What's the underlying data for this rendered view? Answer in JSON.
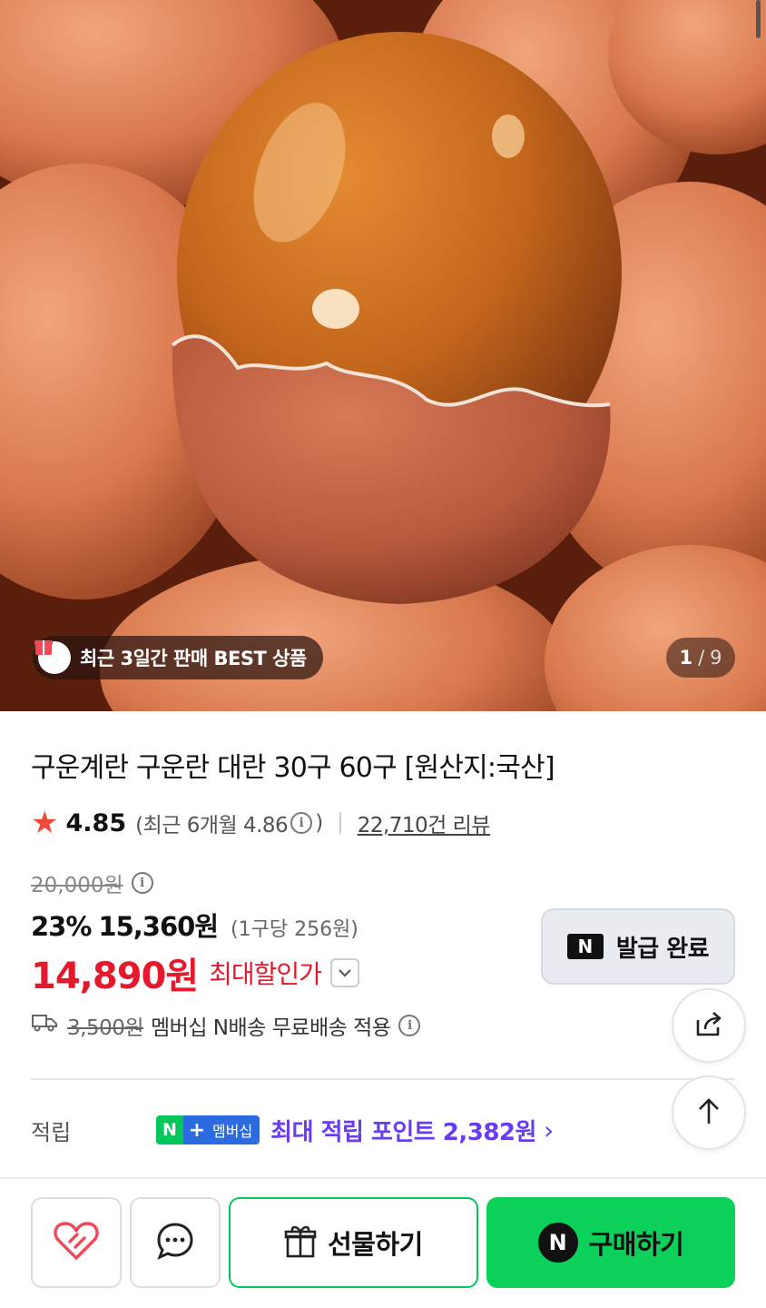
{
  "hero": {
    "badge_text": "최근 3일간 판매 BEST 상품",
    "pager_current": "1",
    "pager_separator": "/",
    "pager_total": "9"
  },
  "product": {
    "title": "구운계란 구운란 대란 30구 60구 [원산지:국산]",
    "rating": "4.85",
    "recent_rating_text": "(최근 6개월 4.86",
    "recent_rating_close": ")",
    "review_count_text": "22,710건 리뷰"
  },
  "price": {
    "original": "20,000원",
    "discount_pct": "23%",
    "sale_price": "15,360원",
    "unit_price": "(1구당 256원)",
    "max_discount_price": "14,890원",
    "max_discount_label": "최대할인가",
    "coupon_button_label": "발급 완료",
    "coupon_brand_mark": "N"
  },
  "shipping": {
    "original_fee": "3,500원",
    "text": "멤버십 N배송 무료배송 적용"
  },
  "points": {
    "label": "적립",
    "membership_n": "N",
    "membership_plus": "+",
    "membership_text": "멤버십",
    "text": "최대 적립 포인트 2,382원",
    "chevron": "›"
  },
  "bottom_bar": {
    "gift_label": "선물하기",
    "buy_label": "구매하기",
    "buy_mark": "N"
  },
  "colors": {
    "sale_red": "#e5192c",
    "naver_green": "#03c75a",
    "points_purple": "#6a3cf0",
    "star": "#f04a3a"
  }
}
